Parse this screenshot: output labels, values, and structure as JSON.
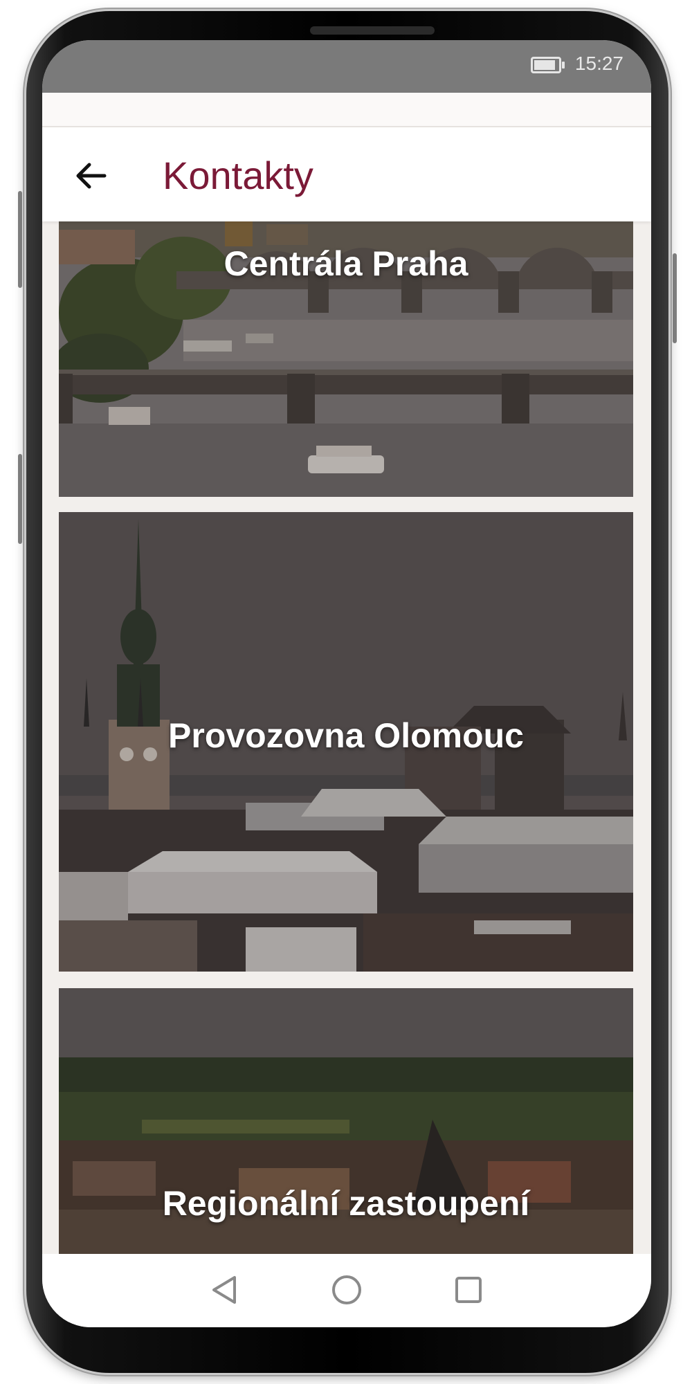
{
  "status_bar": {
    "time": "15:27",
    "battery_icon": "battery-icon"
  },
  "app_bar": {
    "back_icon": "arrow-back-icon",
    "title": "Kontakty",
    "title_color": "#7b1a37"
  },
  "locations": [
    {
      "label": "Centrála Praha",
      "image": "prague-bridges-photo"
    },
    {
      "label": "Provozovna Olomouc",
      "image": "olomouc-townhall-photo"
    },
    {
      "label": "Regionální zastoupení",
      "image": "regional-town-photo"
    }
  ],
  "nav_bar": {
    "back_icon": "nav-back-triangle-icon",
    "home_icon": "nav-home-circle-icon",
    "recents_icon": "nav-recents-square-icon"
  }
}
